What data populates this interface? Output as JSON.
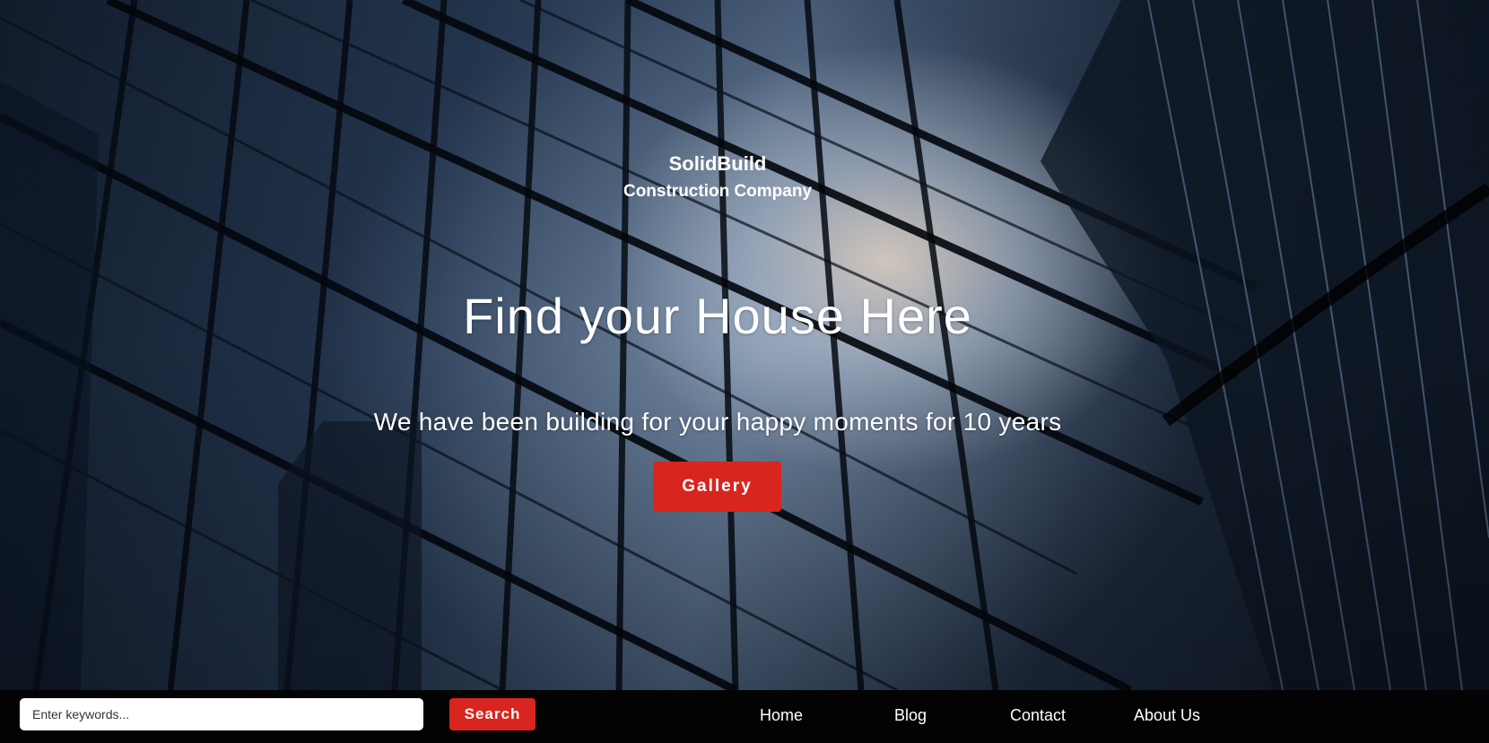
{
  "brand": {
    "name": "SolidBuild",
    "subtitle": "Construction Company"
  },
  "hero": {
    "headline": "Find your House Here",
    "tagline": "We have been building for your happy moments for 10 years",
    "cta_label": "Gallery"
  },
  "search": {
    "placeholder": "Enter keywords...",
    "value": "",
    "button_label": "Search"
  },
  "nav": {
    "items": [
      {
        "label": "Home"
      },
      {
        "label": "Blog"
      },
      {
        "label": "Contact"
      },
      {
        "label": "About Us"
      }
    ]
  },
  "colors": {
    "accent": "#d9251f",
    "bar_background": "#030303",
    "text": "#ffffff"
  }
}
